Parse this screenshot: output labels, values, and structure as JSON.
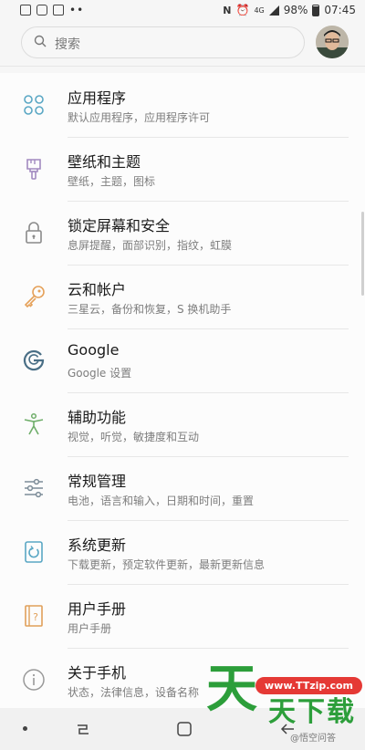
{
  "status_bar": {
    "network": "4G",
    "battery": "98%",
    "time": "07:45",
    "left_dots": "••"
  },
  "search": {
    "placeholder": "搜索"
  },
  "settings_items": [
    {
      "title": "应用程序",
      "subtitle": "默认应用程序，应用程序许可",
      "icon": "apps-grid-icon"
    },
    {
      "title": "壁纸和主题",
      "subtitle": "壁纸，主题，图标",
      "icon": "brush-icon"
    },
    {
      "title": "锁定屏幕和安全",
      "subtitle": "息屏提醒，面部识别，指纹，虹膜",
      "icon": "lock-icon"
    },
    {
      "title": "云和帐户",
      "subtitle": "三星云，备份和恢复，S 换机助手",
      "icon": "key-icon"
    },
    {
      "title": "Google",
      "subtitle": "Google 设置",
      "icon": "google-icon"
    },
    {
      "title": "辅助功能",
      "subtitle": "视觉，听觉，敏捷度和互动",
      "icon": "accessibility-icon"
    },
    {
      "title": "常规管理",
      "subtitle": "电池，语言和输入，日期和时间，重置",
      "icon": "sliders-icon"
    },
    {
      "title": "系统更新",
      "subtitle": "下载更新，预定软件更新，最新更新信息",
      "icon": "system-update-icon"
    },
    {
      "title": "用户手册",
      "subtitle": "用户手册",
      "icon": "user-manual-icon"
    },
    {
      "title": "关于手机",
      "subtitle": "状态，法律信息，设备名称",
      "icon": "info-icon"
    }
  ],
  "watermark": {
    "big_char": "天",
    "url": "www.TTzip.com",
    "text": "天下载",
    "tag": "@悟空问答"
  },
  "colors": {
    "icon_apps": "#5aa7c4",
    "icon_brush": "#a28ac0",
    "icon_lock": "#8a8a8a",
    "icon_key": "#e5a15a",
    "icon_google": "#4a6f86",
    "icon_access": "#6fae6a",
    "icon_sliders": "#7c8c98",
    "icon_update": "#5aa7c4",
    "icon_manual": "#e0a05a",
    "icon_info": "#999999"
  }
}
